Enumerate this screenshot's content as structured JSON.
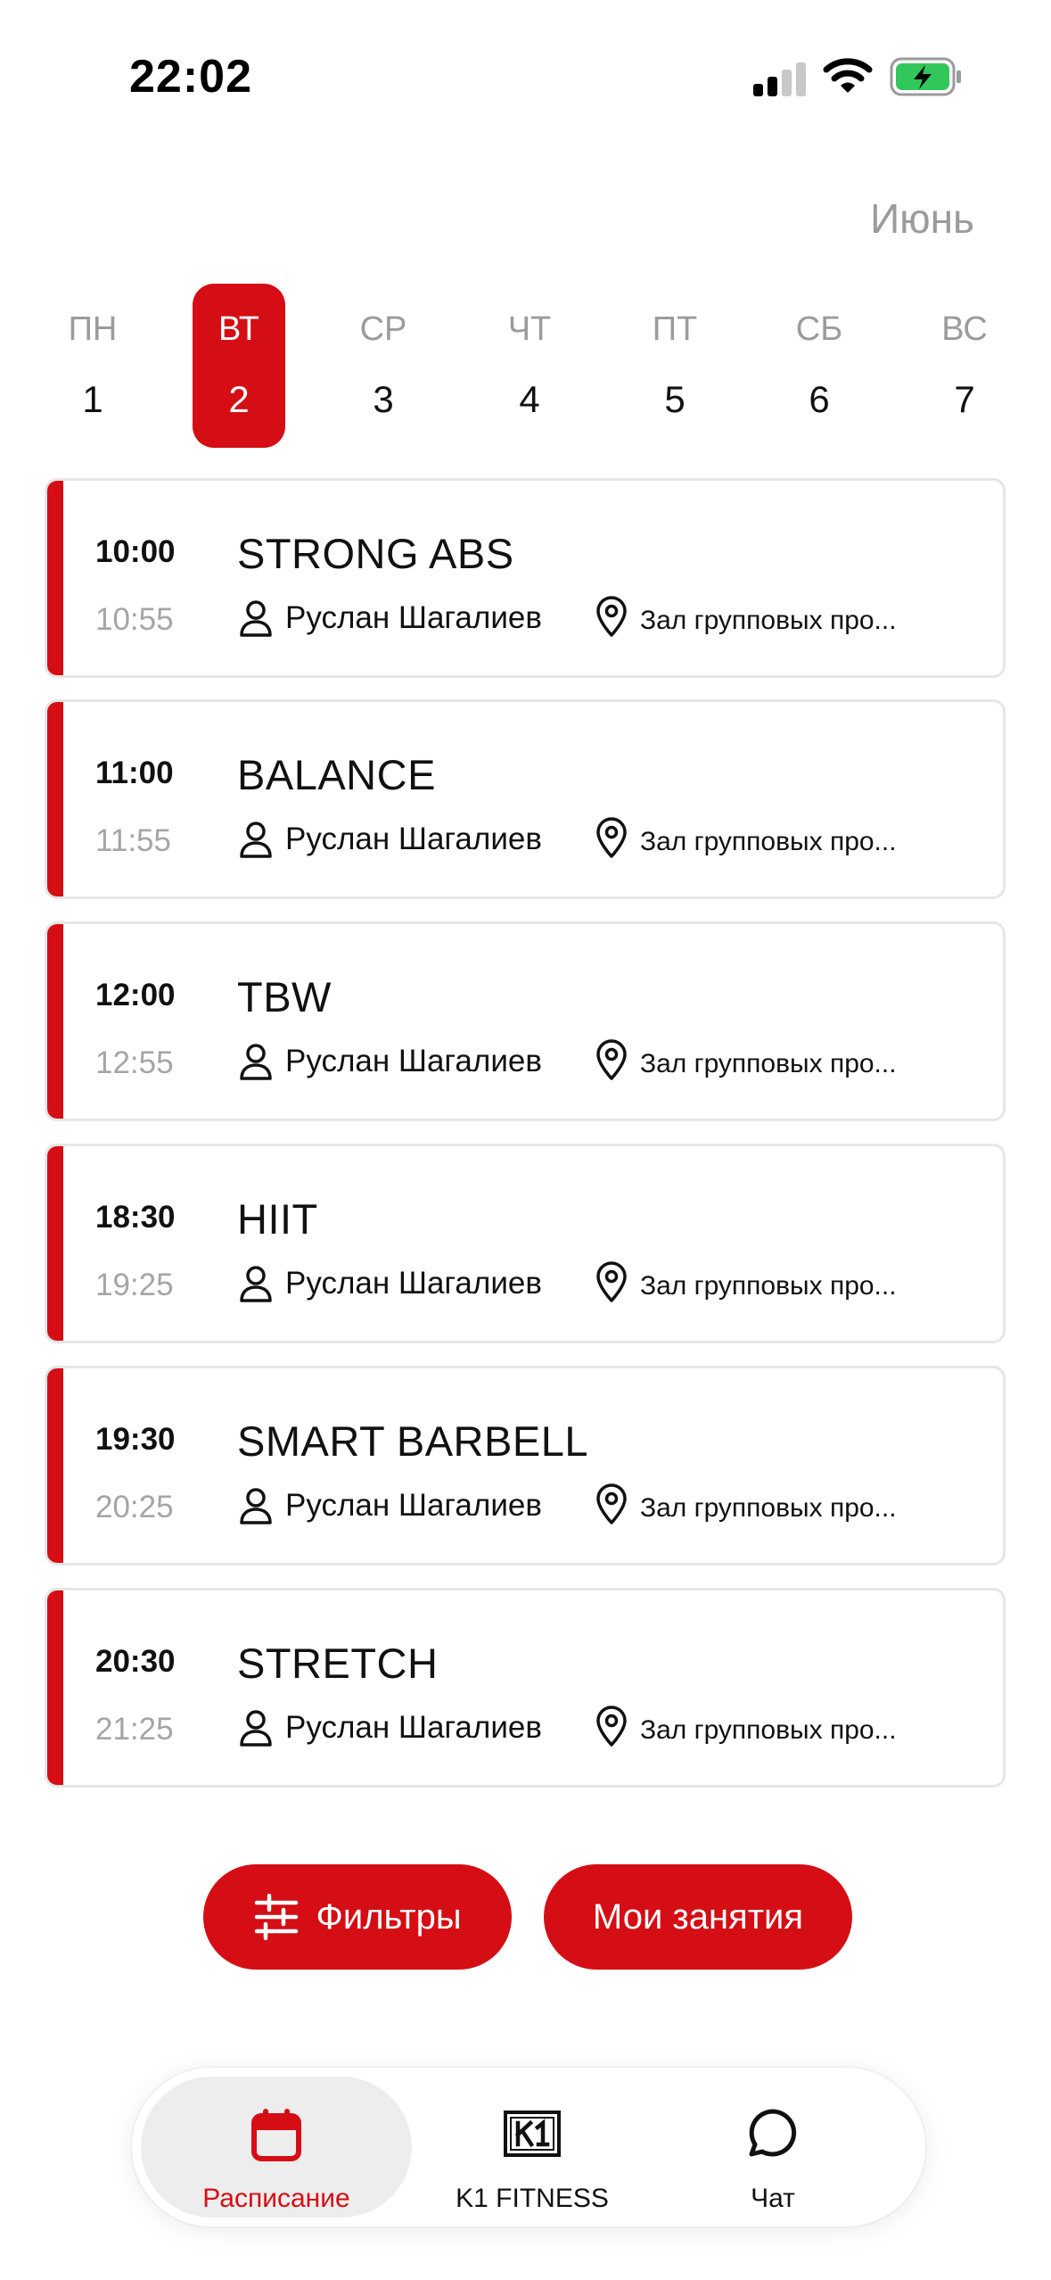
{
  "status_bar": {
    "time": "22:02"
  },
  "header": {
    "month": "Июнь"
  },
  "week": {
    "selected_index": 1,
    "days": [
      {
        "name": "ПН",
        "num": "1"
      },
      {
        "name": "ВТ",
        "num": "2"
      },
      {
        "name": "СР",
        "num": "3"
      },
      {
        "name": "ЧТ",
        "num": "4"
      },
      {
        "name": "ПТ",
        "num": "5"
      },
      {
        "name": "СБ",
        "num": "6"
      },
      {
        "name": "ВС",
        "num": "7"
      }
    ]
  },
  "classes": [
    {
      "start": "10:00",
      "end": "10:55",
      "title": "STRONG ABS",
      "trainer": "Руслан Шагалиев",
      "location": "Зал групповых про..."
    },
    {
      "start": "11:00",
      "end": "11:55",
      "title": "BALANCE",
      "trainer": "Руслан Шагалиев",
      "location": "Зал групповых про..."
    },
    {
      "start": "12:00",
      "end": "12:55",
      "title": "TBW",
      "trainer": "Руслан Шагалиев",
      "location": "Зал групповых про..."
    },
    {
      "start": "18:30",
      "end": "19:25",
      "title": "HIIT",
      "trainer": "Руслан Шагалиев",
      "location": "Зал групповых про..."
    },
    {
      "start": "19:30",
      "end": "20:25",
      "title": "SMART BARBELL",
      "trainer": "Руслан Шагалиев",
      "location": "Зал групповых про..."
    },
    {
      "start": "20:30",
      "end": "21:25",
      "title": "STRETCH",
      "trainer": "Руслан Шагалиев",
      "location": "Зал групповых про..."
    }
  ],
  "actions": {
    "filters_label": "Фильтры",
    "my_classes_label": "Мои занятия"
  },
  "bottom_nav": {
    "items": [
      {
        "label": "Расписание",
        "icon": "calendar-icon",
        "active": true
      },
      {
        "label": "K1 FITNESS",
        "icon": "k1-logo-icon",
        "active": false
      },
      {
        "label": "Чат",
        "icon": "chat-bubble-icon",
        "active": false
      }
    ]
  },
  "colors": {
    "accent": "#d50d14",
    "muted": "#9b9b9b",
    "border": "#e6e6e6",
    "battery": "#32c75a"
  }
}
